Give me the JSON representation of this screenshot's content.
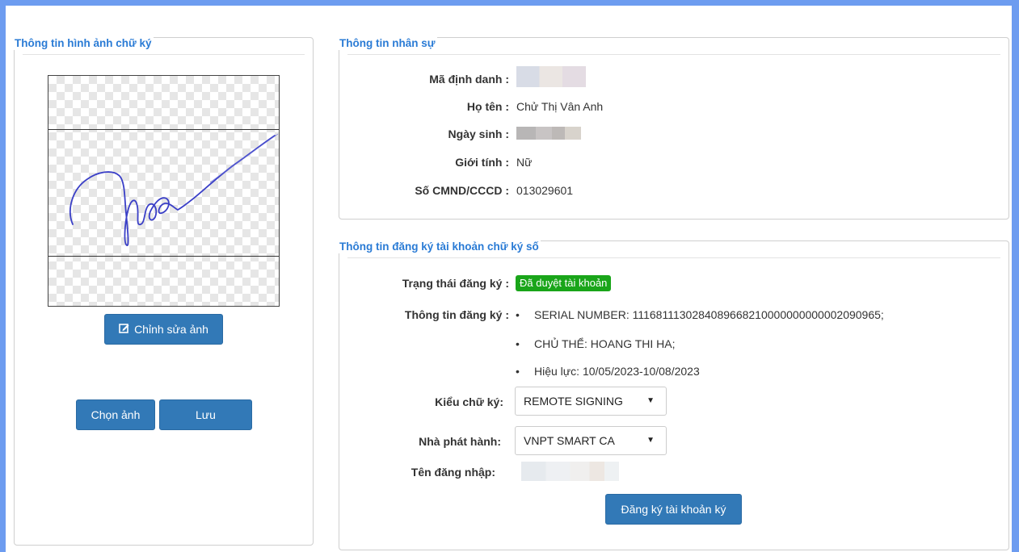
{
  "signature_panel": {
    "title": "Thông tin hình ảnh chữ ký",
    "edit_button": "Chỉnh sửa ảnh",
    "choose_button": "Chọn ảnh",
    "save_button": "Lưu"
  },
  "personnel_panel": {
    "title": "Thông tin nhân sự",
    "fields": {
      "ma_dinh_danh_label": "Mã định danh :",
      "ho_ten_label": "Họ tên :",
      "ho_ten_value": "Chử Thị Vân Anh",
      "ngay_sinh_label": "Ngày sinh :",
      "gioi_tinh_label": "Giới tính :",
      "gioi_tinh_value": "Nữ",
      "cmnd_label": "Số CMND/CCCD :",
      "cmnd_value": "013029601"
    }
  },
  "registration_panel": {
    "title": "Thông tin đăng ký tài khoản chữ ký số",
    "status_label": "Trạng thái đăng ký :",
    "status_value": "Đã duyệt tài khoản",
    "status_color": "#1aa51a",
    "info_label": "Thông tin đăng ký :",
    "info_items": [
      "SERIAL NUMBER: 1116811130284089668210000000000002090965;",
      "CHỦ THỂ: HOANG THI HA;",
      "Hiệu lực: 10/05/2023-10/08/2023"
    ],
    "signing_type_label": "Kiểu chữ ký:",
    "signing_type_value": "REMOTE SIGNING",
    "issuer_label": "Nhà phát hành:",
    "issuer_value": "VNPT SMART CA",
    "username_label": "Tên đăng nhập:",
    "register_button": "Đăng ký tài khoản ký"
  },
  "colors": {
    "accent": "#3279b7",
    "legend": "#2a7bd5",
    "frame": "#6d9cf0"
  }
}
